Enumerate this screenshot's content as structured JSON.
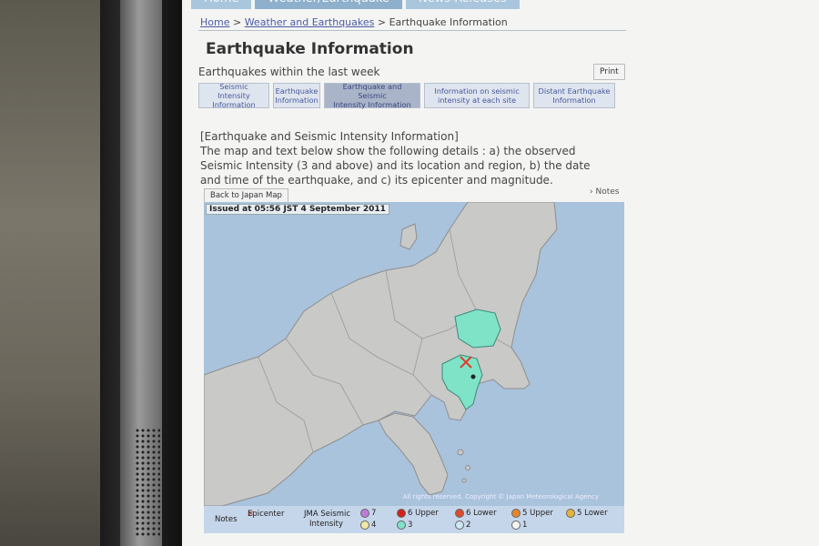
{
  "nav": {
    "tabs": [
      "Home",
      "Weather/Earthquake",
      "News Releases"
    ]
  },
  "breadcrumb": {
    "home": "Home",
    "sep1": ">",
    "weather": "Weather and Earthquakes",
    "sep2": ">",
    "current": "Earthquake Information"
  },
  "page": {
    "title": "Earthquake Information",
    "subtitle": "Earthquakes within the last week",
    "print_label": "Print"
  },
  "subtabs": [
    {
      "line1": "Seismic Intensity",
      "line2": "Information"
    },
    {
      "line1": "Earthquake",
      "line2": "Information"
    },
    {
      "line1": "Earthquake and Seismic",
      "line2": "Intensity Information"
    },
    {
      "line1": "Information on seismic",
      "line2": "intensity at each site"
    },
    {
      "line1": "Distant Earthquake",
      "line2": "Information"
    }
  ],
  "description": {
    "heading": "[Earthquake and Seismic Intensity Information]",
    "line1": "The map and text below show the following details : a) the observed",
    "line2": "Seismic Intensity (3 and above) and its location and region, b) the date",
    "line3": "and time of the earthquake, and c) its epicenter and magnitude."
  },
  "notes_link": "Notes",
  "back_button": "Back to Japan Map",
  "map": {
    "issued": "Issued at 05:56 JST  4 September 2011",
    "copyright": "All rights reserved. Copyright © Japan Meteorological Agency",
    "colors": {
      "sea": "#a9c3dc",
      "land": "#c9c9c7",
      "intensity3": "#7fe3c7",
      "epicenter": "#e03a2a"
    }
  },
  "legend": {
    "notes": "Notes",
    "epicenter": "Epicenter",
    "jma1": "JMA Seismic",
    "jma2": "Intensity",
    "i7": "7",
    "i6u": "6 Upper",
    "i6l": "6 Lower",
    "i5u": "5 Upper",
    "i5l": "5 Lower",
    "i4": "4",
    "i3": "3",
    "i2": "2",
    "i1": "1"
  }
}
